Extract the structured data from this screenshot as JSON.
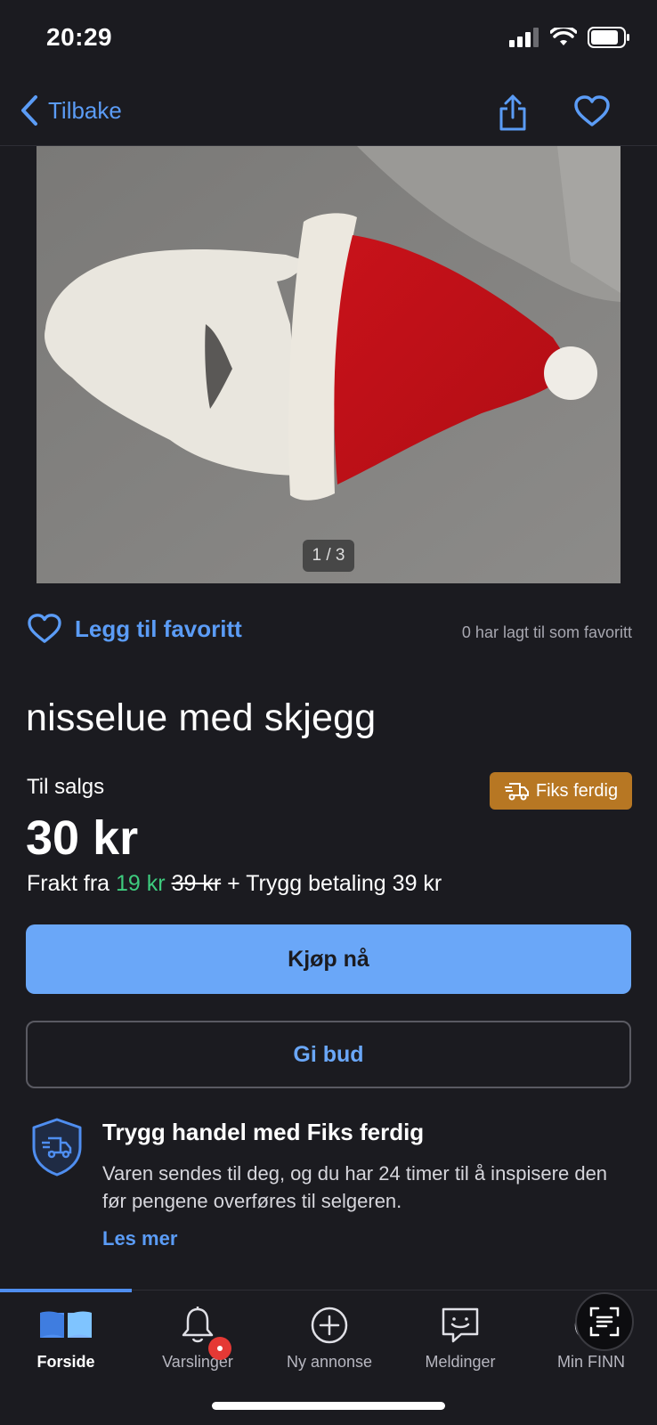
{
  "status_bar": {
    "time": "20:29"
  },
  "nav": {
    "back_label": "Tilbake"
  },
  "photo": {
    "counter": "1 / 3"
  },
  "favorite": {
    "label": "Legg til favoritt",
    "count_text": "0 har lagt til som favoritt"
  },
  "listing": {
    "title": "nisselue med skjegg",
    "sale_type": "Til salgs",
    "badge": "Fiks ferdig",
    "price": "30 kr",
    "shipping_prefix": "Frakt fra",
    "shipping_discount": "19 kr",
    "shipping_original": "39 kr",
    "shipping_suffix": "+ Trygg betaling 39 kr"
  },
  "actions": {
    "buy_label": "Kjøp nå",
    "bid_label": "Gi bud"
  },
  "safe_trade": {
    "title": "Trygg handel med Fiks ferdig",
    "text": "Varen sendes til deg, og du har 24 timer til å inspisere den før pengene overføres til selgeren.",
    "link": "Les mer"
  },
  "tabs": [
    {
      "label": "Forside",
      "icon": "book-icon",
      "active": true
    },
    {
      "label": "Varslinger",
      "icon": "bell-icon",
      "active": false
    },
    {
      "label": "Ny annonse",
      "icon": "plus-circle-icon",
      "active": false
    },
    {
      "label": "Meldinger",
      "icon": "chat-icon",
      "active": false
    },
    {
      "label": "Min FINN",
      "icon": "user-icon",
      "active": false
    }
  ],
  "colors": {
    "accent": "#5b9cf6",
    "badge": "#b77723",
    "discount": "#3ecb7e",
    "background": "#1b1b20"
  }
}
